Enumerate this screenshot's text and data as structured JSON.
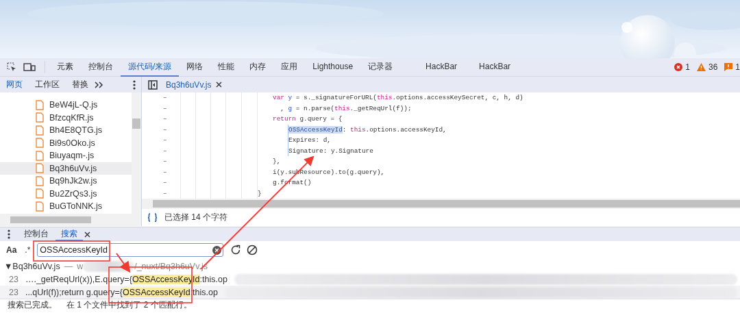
{
  "main_tabs": {
    "items": [
      {
        "label": "元素",
        "selected": false
      },
      {
        "label": "控制台",
        "selected": false
      },
      {
        "label": "源代码/来源",
        "selected": true
      },
      {
        "label": "网络",
        "selected": false
      },
      {
        "label": "性能",
        "selected": false
      },
      {
        "label": "内存",
        "selected": false
      },
      {
        "label": "应用",
        "selected": false
      },
      {
        "label": "Lighthouse",
        "selected": false
      },
      {
        "label": "记录器",
        "selected": false
      },
      {
        "label": "HackBar",
        "selected": false
      },
      {
        "label": "HackBar",
        "selected": false
      }
    ],
    "counters": [
      {
        "kind": "error",
        "count": "1"
      },
      {
        "kind": "warning",
        "count": "36"
      },
      {
        "kind": "issue",
        "count": "1"
      }
    ]
  },
  "navigator": {
    "tabs": [
      {
        "label": "网页",
        "selected": true
      },
      {
        "label": "工作区",
        "selected": false
      },
      {
        "label": "替换",
        "selected": false
      }
    ],
    "files": [
      {
        "name": "BeW4jL-Q.js",
        "selected": false
      },
      {
        "name": "BfzcqKfR.js",
        "selected": false
      },
      {
        "name": "Bh4E8QTG.js",
        "selected": false
      },
      {
        "name": "Bi9s0Oko.js",
        "selected": false
      },
      {
        "name": "Biuyaqm-.js",
        "selected": false
      },
      {
        "name": "Bq3h6uVv.js",
        "selected": true
      },
      {
        "name": "Bq9hJk2w.js",
        "selected": false
      },
      {
        "name": "Bu2ZrQs3.js",
        "selected": false
      },
      {
        "name": "BuGToNNK.js",
        "selected": false
      }
    ]
  },
  "editor": {
    "file_tab": "Bq3h6uVv.js",
    "lines": [
      {
        "gutter": "–",
        "tokens": [
          {
            "kind": "keyword",
            "text": "var "
          },
          {
            "kind": "variable",
            "text": "y"
          },
          {
            "kind": "plain",
            "text": " = s._signatureForURL("
          },
          {
            "kind": "keyword",
            "text": "this"
          },
          {
            "kind": "plain",
            "text": ".options.accessKeySecret, c, h, d)"
          }
        ]
      },
      {
        "gutter": "–",
        "tokens": [
          {
            "kind": "plain",
            "text": "  , "
          },
          {
            "kind": "variable",
            "text": "g"
          },
          {
            "kind": "plain",
            "text": " = n.parse("
          },
          {
            "kind": "keyword",
            "text": "this"
          },
          {
            "kind": "plain",
            "text": "._getReqUrl(f));"
          }
        ]
      },
      {
        "gutter": "–",
        "tokens": [
          {
            "kind": "keyword",
            "text": "return "
          },
          {
            "kind": "plain",
            "text": "g.query = {"
          }
        ]
      },
      {
        "gutter": "–",
        "nested": true,
        "tokens": [
          {
            "kind": "selected",
            "text": "OSSAccessKeyId"
          },
          {
            "kind": "plain",
            "text": ": "
          },
          {
            "kind": "keyword",
            "text": "this"
          },
          {
            "kind": "plain",
            "text": ".options.accessKeyId,"
          }
        ]
      },
      {
        "gutter": "–",
        "nested": true,
        "tokens": [
          {
            "kind": "plain",
            "text": "Expires: d,"
          }
        ]
      },
      {
        "gutter": "–",
        "nested": true,
        "tokens": [
          {
            "kind": "plain",
            "text": "Signature: y.Signature"
          }
        ]
      },
      {
        "gutter": "–",
        "tokens": [
          {
            "kind": "plain",
            "text": "},"
          }
        ]
      },
      {
        "gutter": "–",
        "tokens": [
          {
            "kind": "plain",
            "text": "i(y.subResource).to(g.query),"
          }
        ]
      },
      {
        "gutter": "–",
        "tokens": [
          {
            "kind": "plain",
            "text": "g.format()"
          }
        ]
      },
      {
        "gutter": "–",
        "outdent": true,
        "tokens": [
          {
            "kind": "plain",
            "text": "}"
          }
        ]
      }
    ],
    "status": "已选择 14 个字符"
  },
  "drawer": {
    "tabs": [
      {
        "label": "控制台",
        "selected": false
      },
      {
        "label": "搜索",
        "selected": true
      }
    ],
    "search": {
      "case_toggle": "Aa",
      "regex_toggle": ".*",
      "value": "OSSAccessKeyId"
    },
    "result_file": {
      "name": "▼Bq3h6uVv.js",
      "separator": "—",
      "path_start": "w",
      "path_end": "/_nuxt/Bq3h6uVv.js"
    },
    "matches": [
      {
        "line": "23",
        "before": "…._getReqUrl(x)),E.query={",
        "match": "OSSAccessKeyId",
        "after": ":this.op"
      },
      {
        "line": "23",
        "before": "...qUrl(f));return g.query={",
        "match": "OSSAccessKeyId",
        "after": ":this.op"
      }
    ],
    "status": "搜索已完成。",
    "summary": "在 1 个文件中找到了 2 个匹配行。"
  }
}
